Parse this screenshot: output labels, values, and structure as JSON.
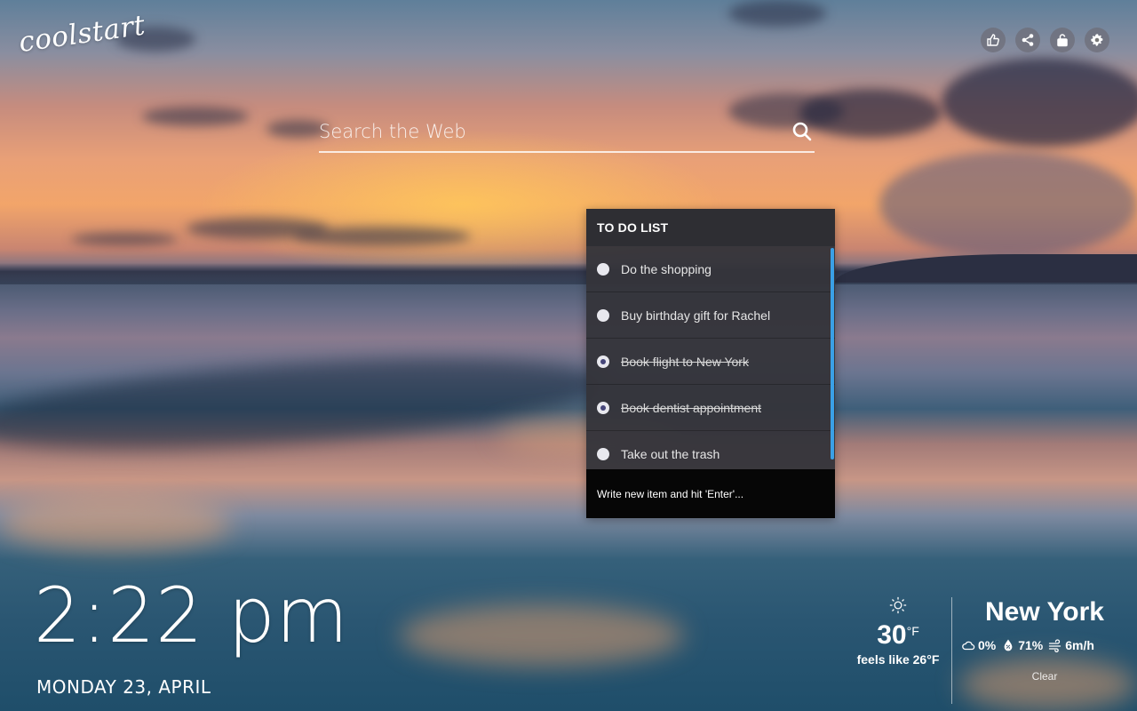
{
  "brand": {
    "logo_text": "coolstart"
  },
  "top_actions": [
    {
      "name": "like-icon",
      "label": "Like"
    },
    {
      "name": "share-icon",
      "label": "Share"
    },
    {
      "name": "lock-icon",
      "label": "Lock"
    },
    {
      "name": "gear-icon",
      "label": "Settings"
    }
  ],
  "search": {
    "placeholder": "Search the Web",
    "value": ""
  },
  "todo": {
    "title": "TO DO LIST",
    "items": [
      {
        "text": "Do the shopping",
        "done": false
      },
      {
        "text": "Buy birthday gift for Rachel",
        "done": false
      },
      {
        "text": "Book flight to New York",
        "done": true
      },
      {
        "text": "Book dentist appointment",
        "done": true
      },
      {
        "text": "Take out the trash",
        "done": false
      }
    ],
    "input_placeholder": "Write new item and hit 'Enter'...",
    "accent_color": "#3aa0e6"
  },
  "clock": {
    "time": "2:22 pm",
    "date": "MONDAY 23, APRIL"
  },
  "weather": {
    "icon": "sun-icon",
    "temperature": "30",
    "unit": "°F",
    "feels_like": "feels like 26°F",
    "city": "New York",
    "cloud_cover": "0%",
    "humidity": "71%",
    "wind": "6m/h",
    "condition": "Clear"
  }
}
